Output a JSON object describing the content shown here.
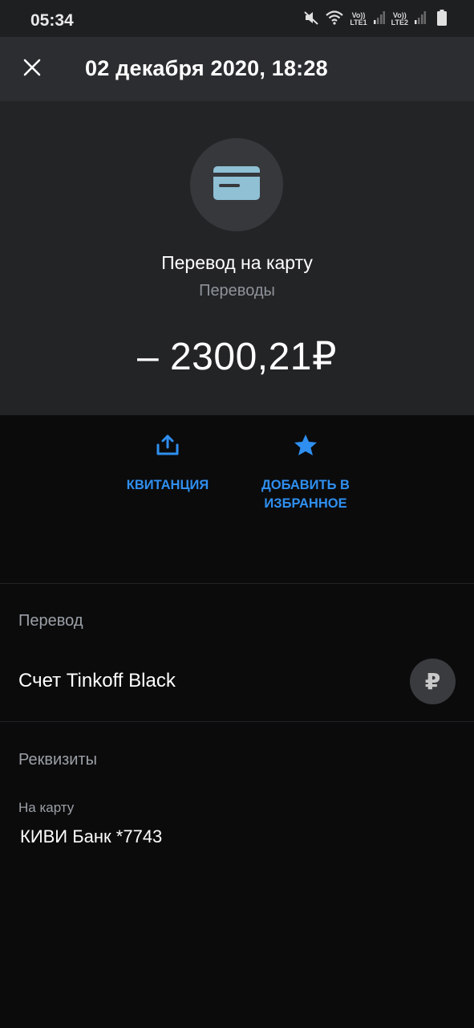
{
  "status_bar": {
    "time": "05:34",
    "icons": [
      "mute-icon",
      "wifi-icon",
      "signal-icon",
      "signal-icon",
      "battery-icon"
    ],
    "sim1_top": "Vo))",
    "sim1_bottom": "LTE1",
    "sim2_top": "Vo))",
    "sim2_bottom": "LTE2"
  },
  "header": {
    "title": "02 декабря 2020, 18:28",
    "close_icon": "close-icon"
  },
  "operation": {
    "icon": "card-icon",
    "title": "Перевод на карту",
    "category": "Переводы",
    "amount": "– 2300,21₽"
  },
  "actions": [
    {
      "label": "КВИТАНЦИЯ",
      "icon": "share-icon"
    },
    {
      "label": "ДОБАВИТЬ В\nИЗБРАННОЕ",
      "icon": "star-icon"
    }
  ],
  "transfer_section": {
    "label": "Перевод",
    "account_name": "Счет Tinkoff Black",
    "currency_symbol": "₽"
  },
  "details_section": {
    "label": "Реквизиты",
    "to_card_caption": "На карту",
    "to_card_value": "КИВИ Банк *7743"
  },
  "colors": {
    "accent": "#2f8ff0",
    "card_icon": "#8fc0d4",
    "background": "#0b0b0c",
    "hero_background": "#232426",
    "header_background": "#2b2d30"
  }
}
